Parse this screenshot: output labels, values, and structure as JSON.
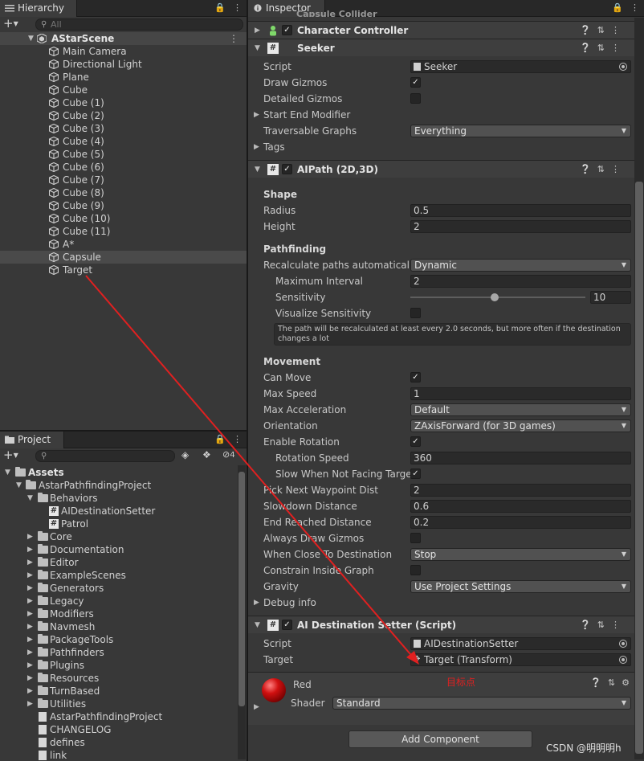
{
  "colors": {
    "panel_bg": "#383838",
    "tabbar_bg": "#282828",
    "selection_bg": "#4a4a4a",
    "annotation_red": "#e02020"
  },
  "hierarchy": {
    "tab_label": "Hierarchy",
    "search_placeholder": "All",
    "scene_name": "AStarScene",
    "items": [
      {
        "label": "Main Camera"
      },
      {
        "label": "Directional Light"
      },
      {
        "label": "Plane"
      },
      {
        "label": "Cube"
      },
      {
        "label": "Cube (1)"
      },
      {
        "label": "Cube (2)"
      },
      {
        "label": "Cube (3)"
      },
      {
        "label": "Cube (4)"
      },
      {
        "label": "Cube (5)"
      },
      {
        "label": "Cube (6)"
      },
      {
        "label": "Cube (7)"
      },
      {
        "label": "Cube (8)"
      },
      {
        "label": "Cube (9)"
      },
      {
        "label": "Cube (10)"
      },
      {
        "label": "Cube (11)"
      },
      {
        "label": "A*"
      },
      {
        "label": "Capsule"
      },
      {
        "label": "Target"
      }
    ]
  },
  "project": {
    "tab_label": "Project",
    "hidden_count": "4",
    "tree": {
      "assets": "Assets",
      "root_folder": "AstarPathfindingProject",
      "behaviors": "Behaviors",
      "scripts": [
        "AIDestinationSetter",
        "Patrol"
      ],
      "folders": [
        "Core",
        "Documentation",
        "Editor",
        "ExampleScenes",
        "Generators",
        "Legacy",
        "Modifiers",
        "Navmesh",
        "PackageTools",
        "Pathfinders",
        "Plugins",
        "Resources",
        "TurnBased",
        "Utilities"
      ],
      "files": [
        "AstarPathfindingProject",
        "CHANGELOG",
        "defines",
        "link"
      ]
    }
  },
  "inspector": {
    "tab_label": "Inspector",
    "partial_component": "Capsule Collider",
    "character_controller": {
      "title": "Character Controller",
      "enabled": true
    },
    "seeker": {
      "title": "Seeker",
      "script_label": "Script",
      "script_value": "Seeker",
      "draw_gizmos_label": "Draw Gizmos",
      "draw_gizmos": true,
      "detailed_gizmos_label": "Detailed Gizmos",
      "detailed_gizmos": false,
      "start_end_modifier_label": "Start End Modifier",
      "traversable_graphs_label": "Traversable Graphs",
      "traversable_graphs_value": "Everything",
      "tags_label": "Tags"
    },
    "aipath": {
      "title": "AIPath (2D,3D)",
      "enabled": true,
      "shape_header": "Shape",
      "radius_label": "Radius",
      "radius": "0.5",
      "height_label": "Height",
      "height": "2",
      "pathfinding_header": "Pathfinding",
      "recalc_label": "Recalculate paths automatically",
      "recalc_value": "Dynamic",
      "max_interval_label": "Maximum Interval",
      "max_interval": "2",
      "sensitivity_label": "Sensitivity",
      "sensitivity": "10",
      "sensitivity_fraction": 0.48,
      "visualize_sensitivity_label": "Visualize Sensitivity",
      "visualize_sensitivity": false,
      "help_text": "The path will be recalculated at least every 2.0 seconds, but more often if the destination changes a lot",
      "movement_header": "Movement",
      "can_move_label": "Can Move",
      "can_move": true,
      "max_speed_label": "Max Speed",
      "max_speed": "1",
      "max_accel_label": "Max Acceleration",
      "max_accel_value": "Default",
      "orientation_label": "Orientation",
      "orientation_value": "ZAxisForward (for 3D games)",
      "enable_rotation_label": "Enable Rotation",
      "enable_rotation": true,
      "rotation_speed_label": "Rotation Speed",
      "rotation_speed": "360",
      "slow_not_facing_label": "Slow When Not Facing Target",
      "slow_not_facing": true,
      "pick_next_label": "Pick Next Waypoint Dist",
      "pick_next": "2",
      "slowdown_label": "Slowdown Distance",
      "slowdown": "0.6",
      "end_reached_label": "End Reached Distance",
      "end_reached": "0.2",
      "always_draw_label": "Always Draw Gizmos",
      "always_draw": false,
      "when_close_label": "When Close To Destination",
      "when_close_value": "Stop",
      "constrain_label": "Constrain Inside Graph",
      "constrain": false,
      "gravity_label": "Gravity",
      "gravity_value": "Use Project Settings",
      "debug_label": "Debug info"
    },
    "ai_destination_setter": {
      "title": "AI Destination Setter (Script)",
      "enabled": true,
      "script_label": "Script",
      "script_value": "AIDestinationSetter",
      "target_label": "Target",
      "target_value": "Target (Transform)"
    },
    "material": {
      "name": "Red",
      "shader_label": "Shader",
      "shader_value": "Standard"
    },
    "add_component": "Add Component"
  },
  "annotation_text": "目标点",
  "watermark": "CSDN @明明明h"
}
